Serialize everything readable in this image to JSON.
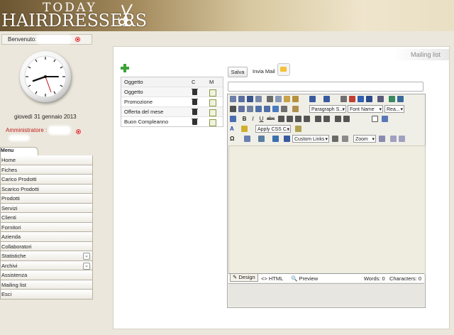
{
  "header": {
    "logo_top": "TODAY",
    "logo_main": "HAIRDRESSERS"
  },
  "welcome": {
    "label": "Benvenuto:"
  },
  "date": "giovedì 31 gennaio 2013",
  "admin_label": "Amministratore :",
  "menu": {
    "header": "Menu",
    "items": [
      {
        "label": "Home"
      },
      {
        "label": "Fiches"
      },
      {
        "label": "Carico Prodotti"
      },
      {
        "label": "Scarico Prodotti"
      },
      {
        "label": "Prodotti"
      },
      {
        "label": "Servizi"
      },
      {
        "label": "Clienti"
      },
      {
        "label": "Fornitori"
      },
      {
        "label": "Azienda"
      },
      {
        "label": "Collaboratori"
      },
      {
        "label": "Statistiche"
      },
      {
        "label": "Archivi"
      },
      {
        "label": "Assistenza"
      },
      {
        "label": "Mailing list"
      },
      {
        "label": "Esci"
      }
    ]
  },
  "panel": {
    "title": "Mailing list"
  },
  "grid": {
    "columns": [
      "Oggetto",
      "C",
      "M"
    ],
    "rows": [
      "Oggetto",
      "Promozione",
      "Offerta del mese",
      "Buon Compleanno"
    ]
  },
  "actions": {
    "save": "Salva",
    "send": "Invia Mail"
  },
  "editor": {
    "paragraph": "Paragraph S...",
    "font": "Font Name",
    "size": "Rea...",
    "css": "Apply CSS C...",
    "links": "Custom Links",
    "zoom": "Zoom",
    "modes": [
      "Design",
      "HTML",
      "Preview"
    ],
    "words": "Words: 0",
    "chars": "Characters: 0"
  },
  "colors": {
    "accent_red": "#d32222",
    "admin_text": "#c01d1d"
  }
}
